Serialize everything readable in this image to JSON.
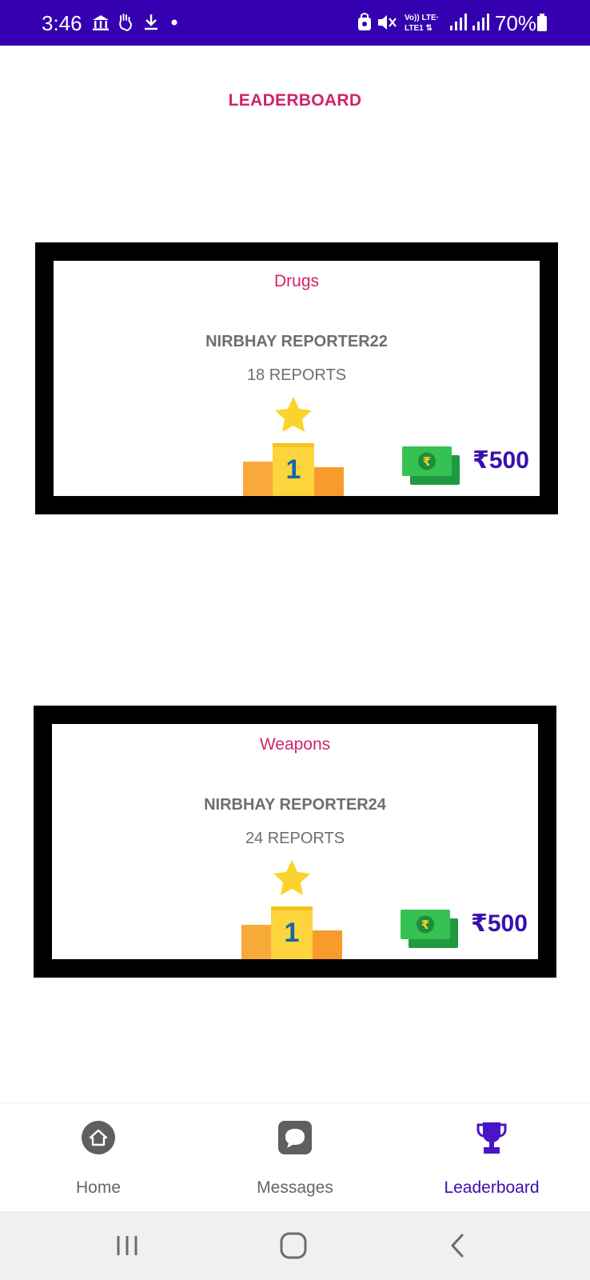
{
  "status_bar": {
    "time": "3:46",
    "battery": "70%",
    "network_label": "Vo)) LTE+\nLTE1",
    "icons": [
      "bank-icon",
      "hand-icon",
      "download-icon",
      "dot-icon",
      "lock-icon",
      "mute-icon",
      "volte-icon",
      "signal-icon",
      "signal-icon",
      "battery-icon"
    ]
  },
  "page": {
    "title": "LEADERBOARD"
  },
  "cards": [
    {
      "category": "Drugs",
      "reporter": "NIRBHAY REPORTER22",
      "reports": "18 REPORTS",
      "rank": "1",
      "prize": "₹500"
    },
    {
      "category": "Weapons",
      "reporter": "NIRBHAY REPORTER24",
      "reports": "24 REPORTS",
      "rank": "1",
      "prize": "₹500"
    }
  ],
  "bottom_nav": {
    "items": [
      {
        "label": "Home",
        "icon": "home-icon",
        "active": false
      },
      {
        "label": "Messages",
        "icon": "message-icon",
        "active": false
      },
      {
        "label": "Leaderboard",
        "icon": "trophy-icon",
        "active": true
      }
    ]
  },
  "system_nav": {
    "buttons": [
      "recents-icon",
      "home-circle-icon",
      "back-icon"
    ]
  },
  "colors": {
    "status_bar": "#3500b0",
    "accent_pink": "#d0246a",
    "accent_purple": "#3a0fb0",
    "card_border": "#000000",
    "text_gray": "#6e6e6e"
  }
}
